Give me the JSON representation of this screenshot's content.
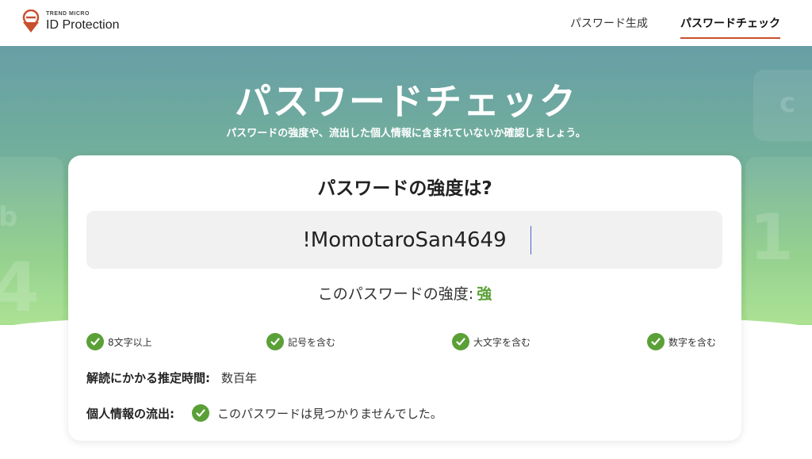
{
  "header": {
    "logo_brand": "TREND MICRO",
    "logo_product": "ID Protection",
    "nav": {
      "generate": "パスワード生成",
      "check": "パスワードチェック"
    }
  },
  "hero": {
    "title": "パスワードチェック",
    "subtitle": "パスワードの強度や、流出した個人情報に含まれていないか確認しましょう。"
  },
  "card": {
    "title": "パスワードの強度は?",
    "password_value": "!MomotaroSan4649",
    "strength_label": "このパスワードの強度:",
    "strength_value": "強",
    "checks": [
      {
        "label": "8文字以上",
        "icon": "check-circle-icon"
      },
      {
        "label": "記号を含む",
        "icon": "check-circle-icon"
      },
      {
        "label": "大文字を含む",
        "icon": "check-circle-icon"
      },
      {
        "label": "数字を含む",
        "icon": "check-circle-icon"
      }
    ],
    "crack_time_label": "解読にかかる推定時間:",
    "crack_time_value": "数百年",
    "leak_label": "個人情報の流出:",
    "leak_value": "このパスワードは見つかりませんでした。"
  },
  "colors": {
    "accent": "#c9502f",
    "success": "#5aa037",
    "hero_top": "#679ea6",
    "hero_bottom": "#a6e08c"
  }
}
